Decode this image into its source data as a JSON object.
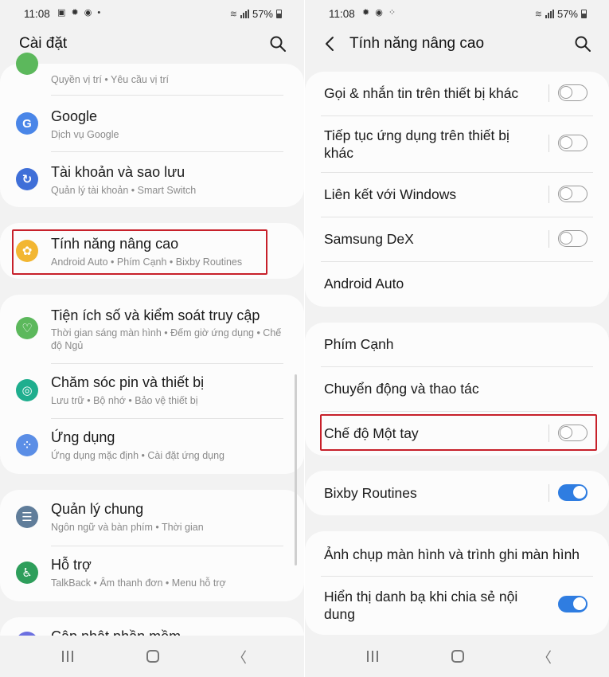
{
  "status": {
    "left_time": "11:08",
    "right_time": "11:08",
    "battery": "57%"
  },
  "left": {
    "title": "Cài đặt",
    "partial_top": {
      "subtitle": "Quyền vị trí  •  Yêu cầu vị trí"
    },
    "items": [
      {
        "title": "Google",
        "subtitle": "Dịch vụ Google",
        "icon": "google-icon",
        "color": "#4a86e8"
      },
      {
        "title": "Tài khoản và sao lưu",
        "subtitle": "Quản lý tài khoản  •  Smart Switch",
        "icon": "sync-icon",
        "color": "#3f6fd8"
      },
      {
        "title": "Tính năng nâng cao",
        "subtitle": "Android Auto  •  Phím Cạnh  •  Bixby Routines",
        "icon": "advanced-gear-icon",
        "color": "#f2b632"
      },
      {
        "title": "Tiện ích số và kiểm soát truy cập",
        "subtitle": "Thời gian sáng màn hình  •  Đếm giờ ứng dụng  •  Chế độ Ngủ",
        "icon": "digital-wellbeing-icon",
        "color": "#5cb85c"
      },
      {
        "title": "Chăm sóc pin và thiết bị",
        "subtitle": "Lưu trữ  •  Bộ nhớ  •  Bảo vệ thiết bị",
        "icon": "device-care-icon",
        "color": "#1fae8e"
      },
      {
        "title": "Ứng dụng",
        "subtitle": "Ứng dụng mặc định  •  Cài đặt ứng dụng",
        "icon": "apps-icon",
        "color": "#5b8ee6"
      },
      {
        "title": "Quản lý chung",
        "subtitle": "Ngôn ngữ và bàn phím  •  Thời gian",
        "icon": "general-management-icon",
        "color": "#607d9a"
      },
      {
        "title": "Hỗ trợ",
        "subtitle": "TalkBack  •  Âm thanh đơn  •  Menu hỗ trợ",
        "icon": "accessibility-icon",
        "color": "#2e9e5b"
      },
      {
        "title": "Cập nhật phần mềm",
        "subtitle": "",
        "icon": "software-update-icon",
        "color": "#6b6fe0"
      }
    ]
  },
  "right": {
    "title": "Tính năng nâng cao",
    "items": [
      {
        "label": "Gọi & nhắn tin trên thiết bị khác",
        "toggle": false
      },
      {
        "label": "Tiếp tục ứng dụng trên thiết bị khác",
        "toggle": false
      },
      {
        "label": "Liên kết với Windows",
        "toggle": false
      },
      {
        "label": "Samsung DeX",
        "toggle": false
      },
      {
        "label": "Android Auto",
        "toggle": null
      },
      {
        "label": "Phím Cạnh",
        "toggle": null
      },
      {
        "label": "Chuyển động và thao tác",
        "toggle": null
      },
      {
        "label": "Chế độ Một tay",
        "toggle": false
      },
      {
        "label": "Bixby Routines",
        "toggle": true
      },
      {
        "label": "Ảnh chụp màn hình và trình ghi màn hình",
        "toggle": null
      },
      {
        "label": "Hiển thị danh bạ khi chia sẻ nội dung",
        "toggle": true
      }
    ]
  },
  "colors": {
    "accent": "#2f7de1",
    "highlight": "#c7202a",
    "background": "#f2f2f2",
    "card": "#fcfcfc"
  }
}
